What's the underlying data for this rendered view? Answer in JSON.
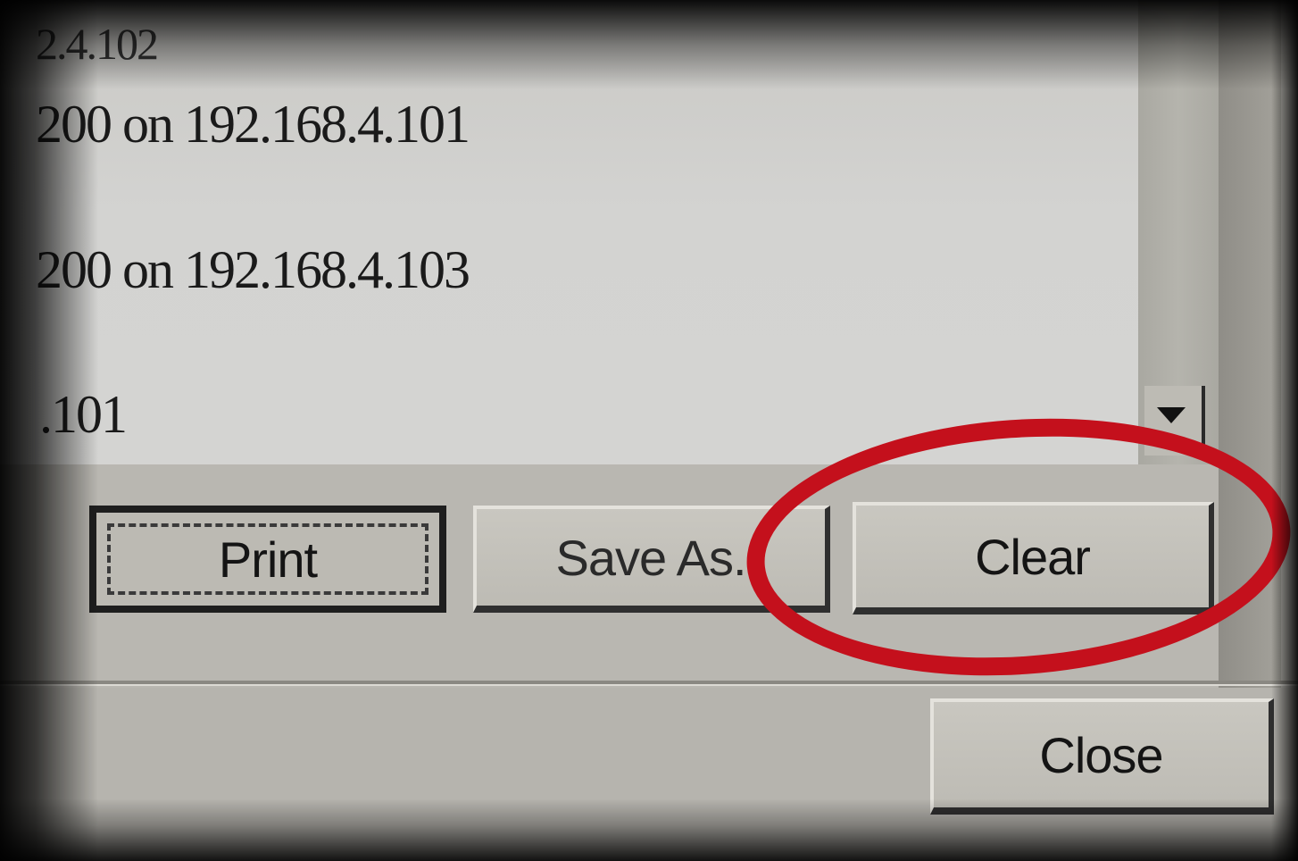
{
  "log": {
    "lines": [
      "2.4.102",
      "200 on 192.168.4.101",
      "200 on 192.168.4.103",
      ".101"
    ]
  },
  "buttons": {
    "print": "Print",
    "save_as": "Save As.",
    "clear": "Clear",
    "close": "Close"
  },
  "icons": {
    "scroll_down": "scroll-down-arrow-icon"
  },
  "colors": {
    "highlight": "#c4101c",
    "panel": "#b9b7b1"
  }
}
